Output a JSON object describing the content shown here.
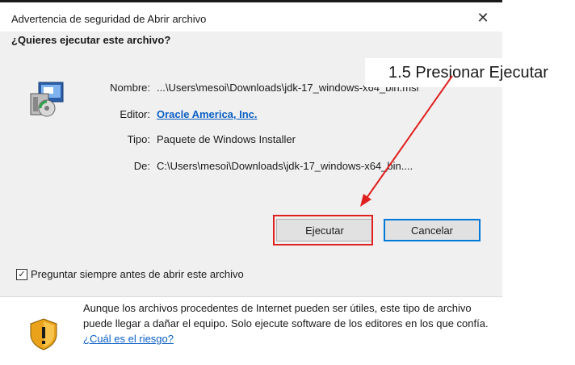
{
  "window": {
    "title": "Advertencia de seguridad de Abrir archivo",
    "close_glyph": "✕"
  },
  "question": "¿Quieres ejecutar este archivo?",
  "file_icon": "installer-package-icon",
  "details": [
    {
      "label": "Nombre:",
      "value": "...\\Users\\mesoi\\Downloads\\jdk-17_windows-x64_bin.msi",
      "is_link": false
    },
    {
      "label": "Editor:",
      "value": "Oracle America, Inc.",
      "is_link": true
    },
    {
      "label": "Tipo:",
      "value": "Paquete de Windows Installer",
      "is_link": false
    },
    {
      "label": "De:",
      "value": "C:\\Users\\mesoi\\Downloads\\jdk-17_windows-x64_bin....",
      "is_link": false
    }
  ],
  "buttons": {
    "run": "Ejecutar",
    "cancel": "Cancelar"
  },
  "checkbox": {
    "label": "Preguntar siempre antes de abrir este archivo",
    "checked": true,
    "mark": "✓"
  },
  "warning": {
    "icon": "shield-warning-icon",
    "text": "Aunque los archivos procedentes de Internet pueden ser útiles, este tipo de archivo puede llegar a dañar el equipo. Solo ejecute software de los editores en los que confía.",
    "link": "¿Cuál es el riesgo?"
  },
  "annotation": {
    "text": "1.5 Presionar Ejecutar",
    "color": "#e0201e"
  }
}
